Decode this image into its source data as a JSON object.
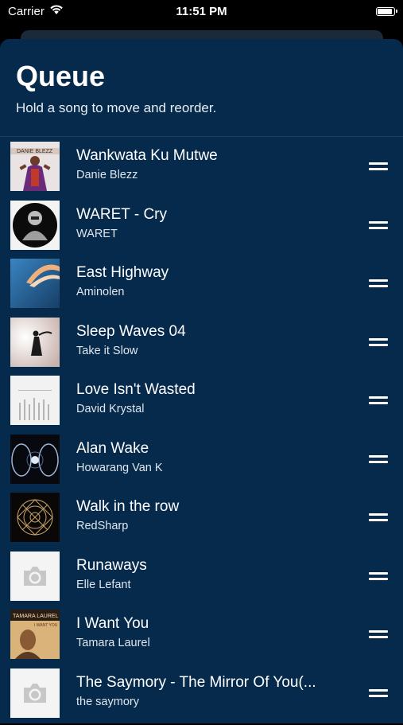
{
  "status": {
    "carrier": "Carrier",
    "time": "11:51 PM"
  },
  "sheet": {
    "title": "Queue",
    "subtitle": "Hold a song to move and reorder."
  },
  "queue": [
    {
      "title": "Wankwata Ku Mutwe",
      "artist": "Danie Blezz",
      "art": "danie-blezz-cover"
    },
    {
      "title": "WARET - Cry",
      "artist": "WARET",
      "art": "waret-cover"
    },
    {
      "title": "East Highway",
      "artist": "Aminolen",
      "art": "east-highway-cover"
    },
    {
      "title": "Sleep Waves 04",
      "artist": "Take it Slow",
      "art": "sleep-waves-cover"
    },
    {
      "title": "Love Isn't Wasted",
      "artist": "David Krystal",
      "art": "love-isnt-wasted-cover"
    },
    {
      "title": "Alan Wake",
      "artist": "Howarang Van K",
      "art": "alan-wake-cover"
    },
    {
      "title": "Walk in the row",
      "artist": "RedSharp",
      "art": "walk-in-the-row-cover"
    },
    {
      "title": "Runaways",
      "artist": "Elle Lefant",
      "art": "camera-placeholder-icon"
    },
    {
      "title": "I Want You",
      "artist": "Tamara Laurel",
      "art": "tamara-laurel-cover"
    },
    {
      "title": "The Saymory - The Mirror Of You(...",
      "artist": "the saymory",
      "art": "camera-placeholder-icon"
    }
  ],
  "colors": {
    "sheet_bg": "#062a4b",
    "divider": "#17406a",
    "behind_card": "#1b2a3a"
  }
}
